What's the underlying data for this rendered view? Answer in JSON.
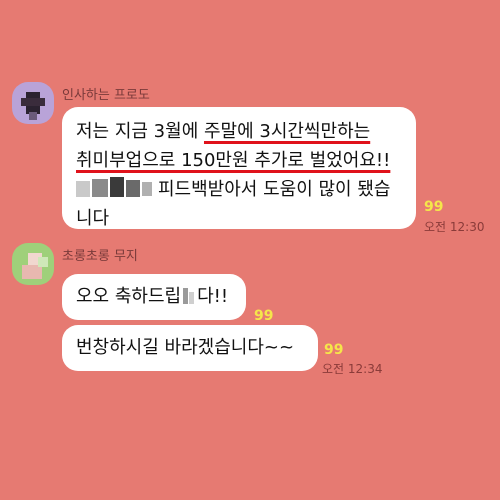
{
  "messages": [
    {
      "sender": "인사하는 프로도",
      "avatar_icon": "pixelated-avatar-icon",
      "lines": {
        "l1_prefix": "저는 지금 3월에 ",
        "l1_ul": "주말에 3시간씩만하는",
        "l2_ul": "취미부업으로 150만원 추가로 벌었어요!!",
        "l3": "피드백받아서 도움이 많이 됐습",
        "l4": "니다"
      },
      "unread": "99",
      "time": "오전 12:30"
    },
    {
      "sender": "초롱초롱 무지",
      "avatar_icon": "pixelated-avatar-icon",
      "bubbles": [
        {
          "pre": "오오 축하드립",
          "post": "다!!",
          "unread": "99"
        },
        {
          "text": "번창하시길 바라겠습니다~~",
          "unread": "99",
          "time": "오전 12:34"
        }
      ]
    }
  ],
  "colors": {
    "background": "#e67a72",
    "bubble": "#ffffff",
    "underline": "#e0121b",
    "unread": "#f5e64a"
  }
}
